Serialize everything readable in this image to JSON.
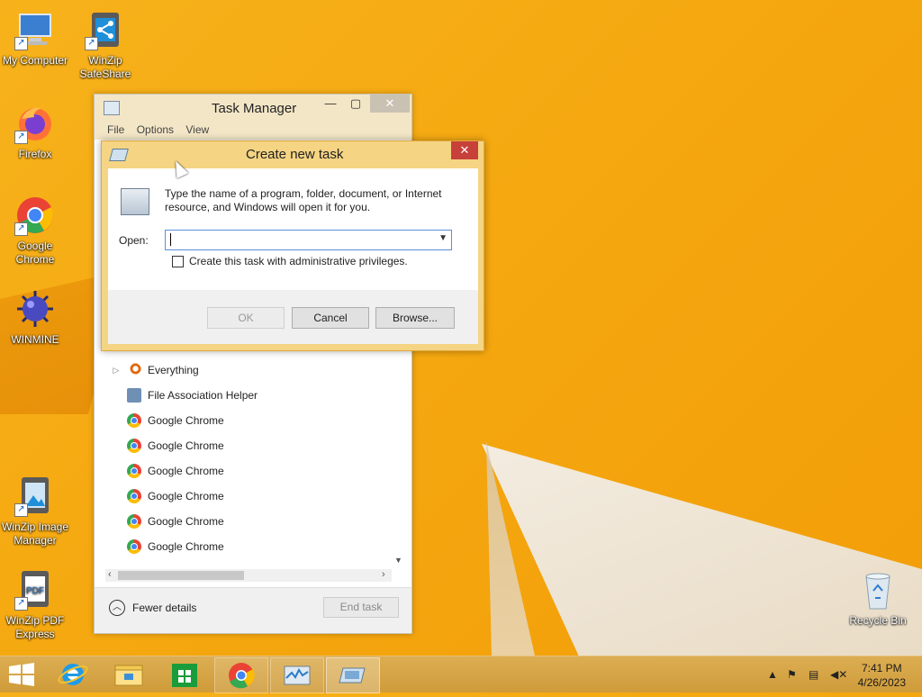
{
  "desktop": {
    "icons": [
      {
        "label": "My Computer",
        "icon": "computer-icon"
      },
      {
        "label": "WinZip SafeShare",
        "icon": "winzip-safeshare-icon"
      },
      {
        "label": "Firefox",
        "icon": "firefox-icon"
      },
      {
        "label": "Google Chrome",
        "icon": "chrome-icon"
      },
      {
        "label": "WINMINE",
        "icon": "mine-icon"
      },
      {
        "label": "WinZip Image Manager",
        "icon": "winzip-image-icon"
      },
      {
        "label": "WinZip PDF Express",
        "icon": "pdf-icon"
      },
      {
        "label": "Recycle Bin",
        "icon": "recycle-bin-icon"
      }
    ]
  },
  "task_manager": {
    "title": "Task Manager",
    "menu": [
      "File",
      "Options",
      "View"
    ],
    "apps": [
      {
        "name": "Everything",
        "icon": "search-icon",
        "expandable": true
      },
      {
        "name": "File Association Helper",
        "icon": "app-icon",
        "expandable": false
      },
      {
        "name": "Google Chrome",
        "icon": "chrome-icon",
        "expandable": false
      },
      {
        "name": "Google Chrome",
        "icon": "chrome-icon",
        "expandable": false
      },
      {
        "name": "Google Chrome",
        "icon": "chrome-icon",
        "expandable": false
      },
      {
        "name": "Google Chrome",
        "icon": "chrome-icon",
        "expandable": false
      },
      {
        "name": "Google Chrome",
        "icon": "chrome-icon",
        "expandable": false
      },
      {
        "name": "Google Chrome",
        "icon": "chrome-icon",
        "expandable": false
      }
    ],
    "fewer_details": "Fewer details",
    "end_task": "End task"
  },
  "dialog": {
    "title": "Create new task",
    "description": "Type the name of a program, folder, document, or Internet resource, and Windows will open it for you.",
    "open_label": "Open:",
    "open_value": "",
    "admin_checkbox": "Create this task with administrative privileges.",
    "ok": "OK",
    "cancel": "Cancel",
    "browse": "Browse..."
  },
  "taskbar": {
    "items": [
      "start-icon",
      "ie-icon",
      "file-explorer-icon",
      "store-icon",
      "chrome-icon",
      "task-manager-icon",
      "run-icon"
    ],
    "time": "7:41 PM",
    "date": "4/26/2023"
  },
  "colors": {
    "accent": "#f5a810",
    "dialog_frame": "#f5d483",
    "close_red": "#c7403a"
  }
}
